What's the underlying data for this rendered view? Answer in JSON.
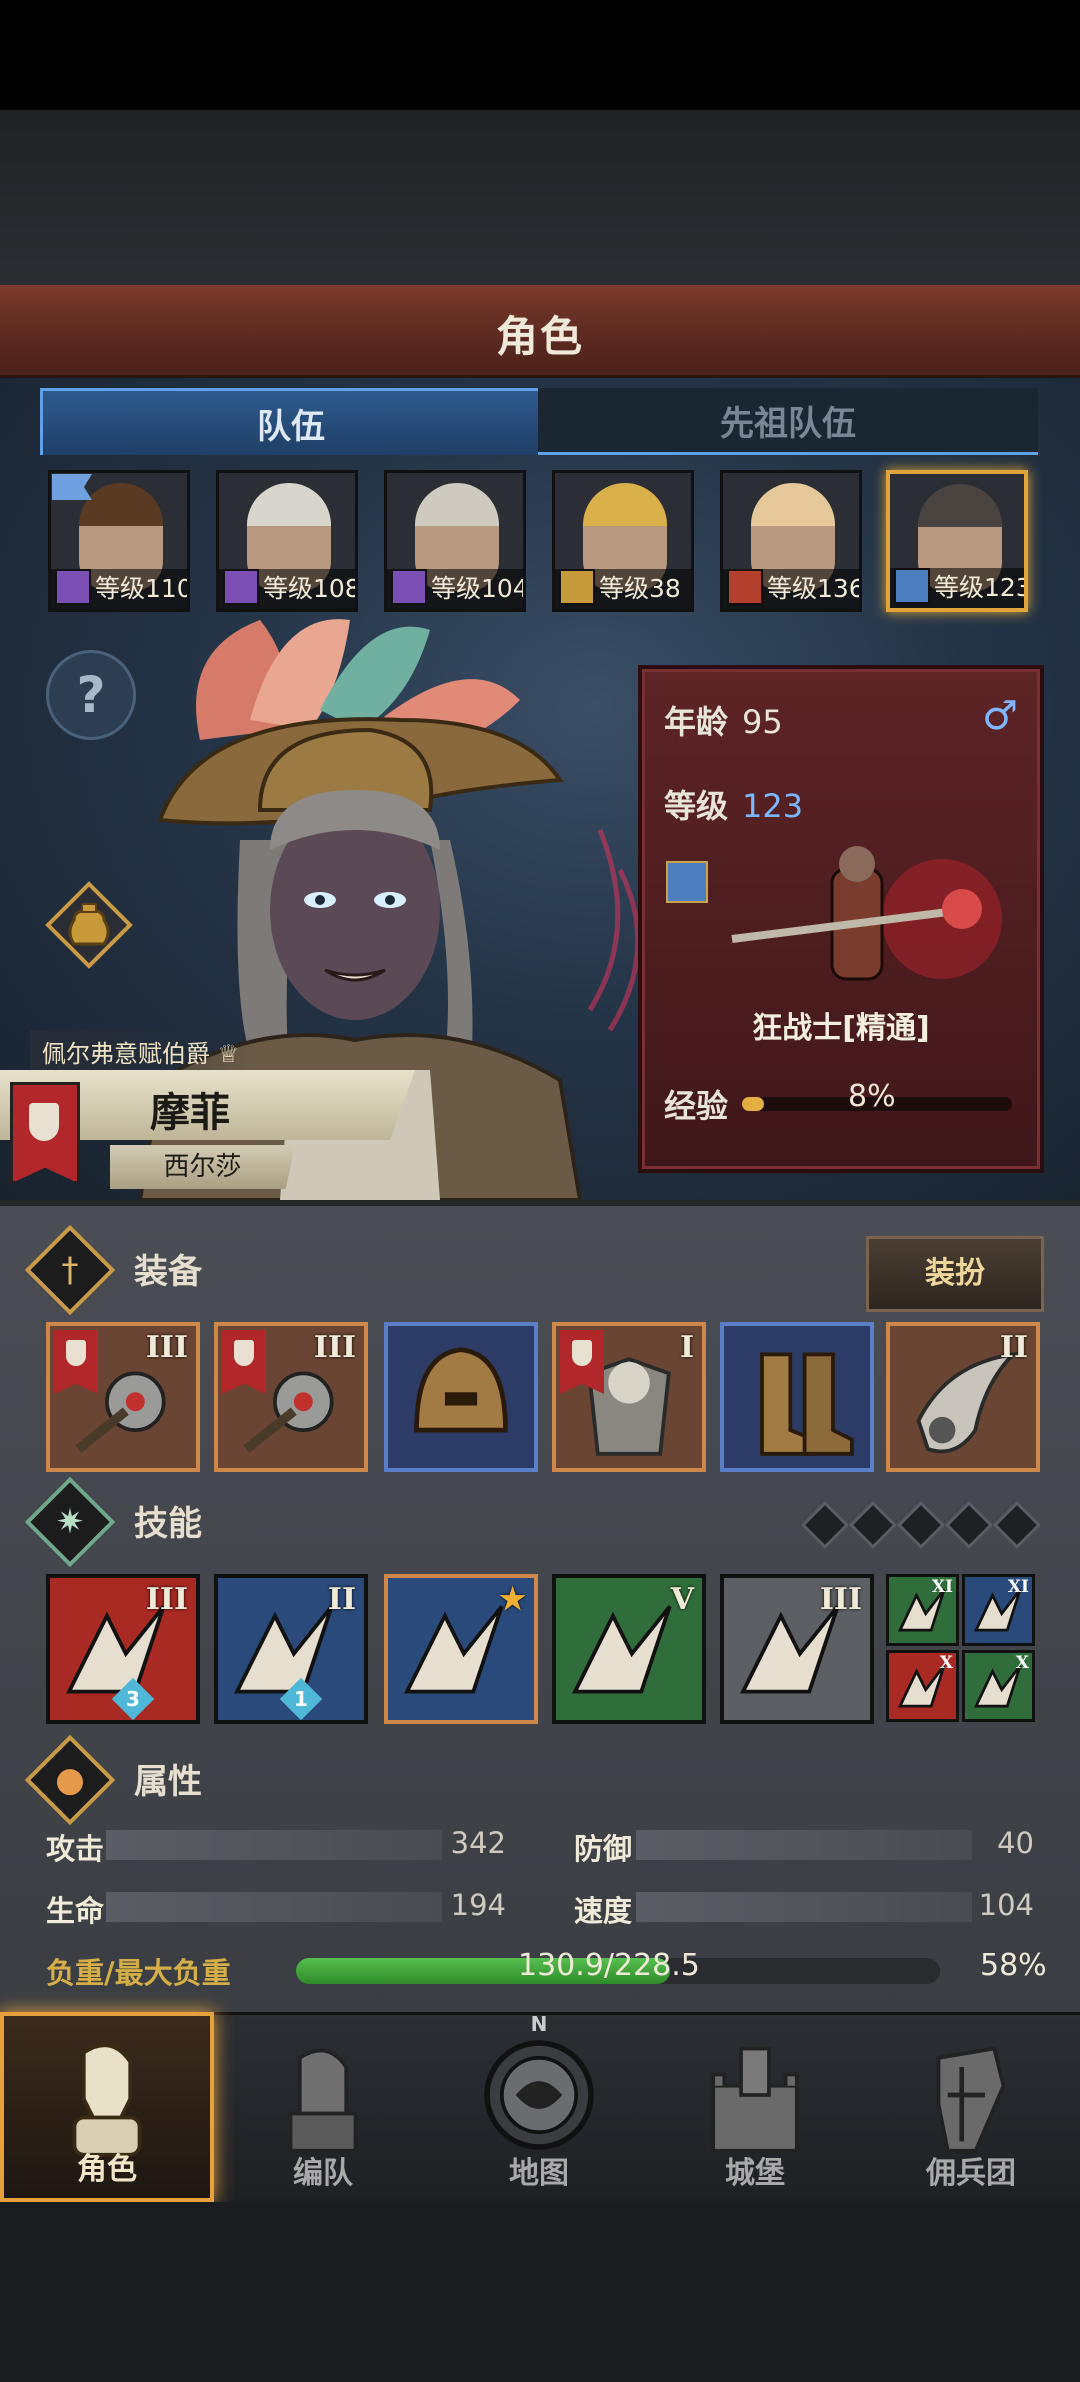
{
  "screen_title": "角色",
  "tabs": [
    {
      "label": "队伍",
      "active": true
    },
    {
      "label": "先祖队伍",
      "active": false
    }
  ],
  "party": [
    {
      "level_text": "等级110",
      "class_icon": "staff-icon",
      "class_color": "#7b4fb3",
      "hair": "#5a3a22"
    },
    {
      "level_text": "等级108",
      "class_icon": "staff-icon",
      "class_color": "#7b4fb3",
      "hair": "#d8d5cc"
    },
    {
      "level_text": "等级104",
      "class_icon": "staff-icon",
      "class_color": "#7b4fb3",
      "hair": "#cfcac0"
    },
    {
      "level_text": "等级38",
      "class_icon": "shield-icon",
      "class_color": "#c79b3c",
      "hair": "#d9b04a"
    },
    {
      "level_text": "等级136",
      "class_icon": "beast-icon",
      "class_color": "#b2402c",
      "hair": "#e6c89a"
    },
    {
      "level_text": "等级123",
      "class_icon": "sword-icon",
      "class_color": "#4d7fc0",
      "hair": "#4a4440"
    }
  ],
  "character": {
    "title": "佩尔弗意赋伯爵",
    "name": "摩菲",
    "subname": "西尔莎",
    "age_label": "年龄",
    "age": "95",
    "level_label": "等级",
    "level": "123",
    "class_name": "狂战士[精通]",
    "xp_label": "经验",
    "xp_percent_text": "8%",
    "xp_fraction": 0.08
  },
  "equipment": {
    "header": "装备",
    "dress_button": "装扮",
    "slots": [
      {
        "tier": "III",
        "tagged": true,
        "frame": "orange",
        "icon": "flail-icon"
      },
      {
        "tier": "III",
        "tagged": true,
        "frame": "orange",
        "icon": "flail-icon"
      },
      {
        "tier": "",
        "tagged": false,
        "frame": "blue",
        "icon": "helmet-icon"
      },
      {
        "tier": "I",
        "tagged": true,
        "frame": "orange",
        "icon": "armor-icon"
      },
      {
        "tier": "",
        "tagged": false,
        "frame": "blue",
        "icon": "boots-icon"
      },
      {
        "tier": "II",
        "tagged": false,
        "frame": "orange",
        "icon": "horn-icon"
      }
    ]
  },
  "skills": {
    "header": "技能",
    "pips": 5,
    "items": [
      {
        "tier": "III",
        "badge": "3",
        "bg": "#a82a22",
        "icon": "slash-skill-icon",
        "frame": "#111"
      },
      {
        "tier": "II",
        "badge": "1",
        "bg": "#2b4a7c",
        "icon": "leap-skill-icon",
        "frame": "#111"
      },
      {
        "tier": "★",
        "badge": "",
        "bg": "#2b4a7c",
        "icon": "claw-skill-icon",
        "frame": "#d0884a"
      },
      {
        "tier": "V",
        "badge": "",
        "bg": "#2f6e3a",
        "icon": "burst-skill-icon",
        "frame": "#111"
      },
      {
        "tier": "III",
        "badge": "",
        "bg": "#5c5f63",
        "icon": "crystal-skill-icon",
        "frame": "#111"
      }
    ],
    "minis": [
      {
        "tier": "XI",
        "bg": "#2f6e3a",
        "icon": "mini-skill-icon"
      },
      {
        "tier": "XI",
        "bg": "#2b4a7c",
        "icon": "mini-skill-icon"
      },
      {
        "tier": "X",
        "bg": "#a82a22",
        "icon": "mini-skill-icon"
      },
      {
        "tier": "X",
        "bg": "#2f6e3a",
        "icon": "mini-skill-icon"
      }
    ]
  },
  "attributes": {
    "header": "属性",
    "attack_label": "攻击",
    "attack": "342",
    "defense_label": "防御",
    "defense": "40",
    "hp_label": "生命",
    "hp": "194",
    "speed_label": "速度",
    "speed": "104",
    "load_label": "负重/最大负重",
    "load_text": "130.9/228.5",
    "load_percent_text": "58%",
    "load_fraction": 0.58
  },
  "nav": [
    {
      "label": "角色",
      "icon": "knight-icon",
      "active": true
    },
    {
      "label": "编队",
      "icon": "formation-icon",
      "active": false
    },
    {
      "label": "地图",
      "icon": "compass-map-icon",
      "active": false
    },
    {
      "label": "城堡",
      "icon": "castle-icon",
      "active": false
    },
    {
      "label": "佣兵团",
      "icon": "mercenary-icon",
      "active": false
    }
  ],
  "nav_compass_letter": "N"
}
